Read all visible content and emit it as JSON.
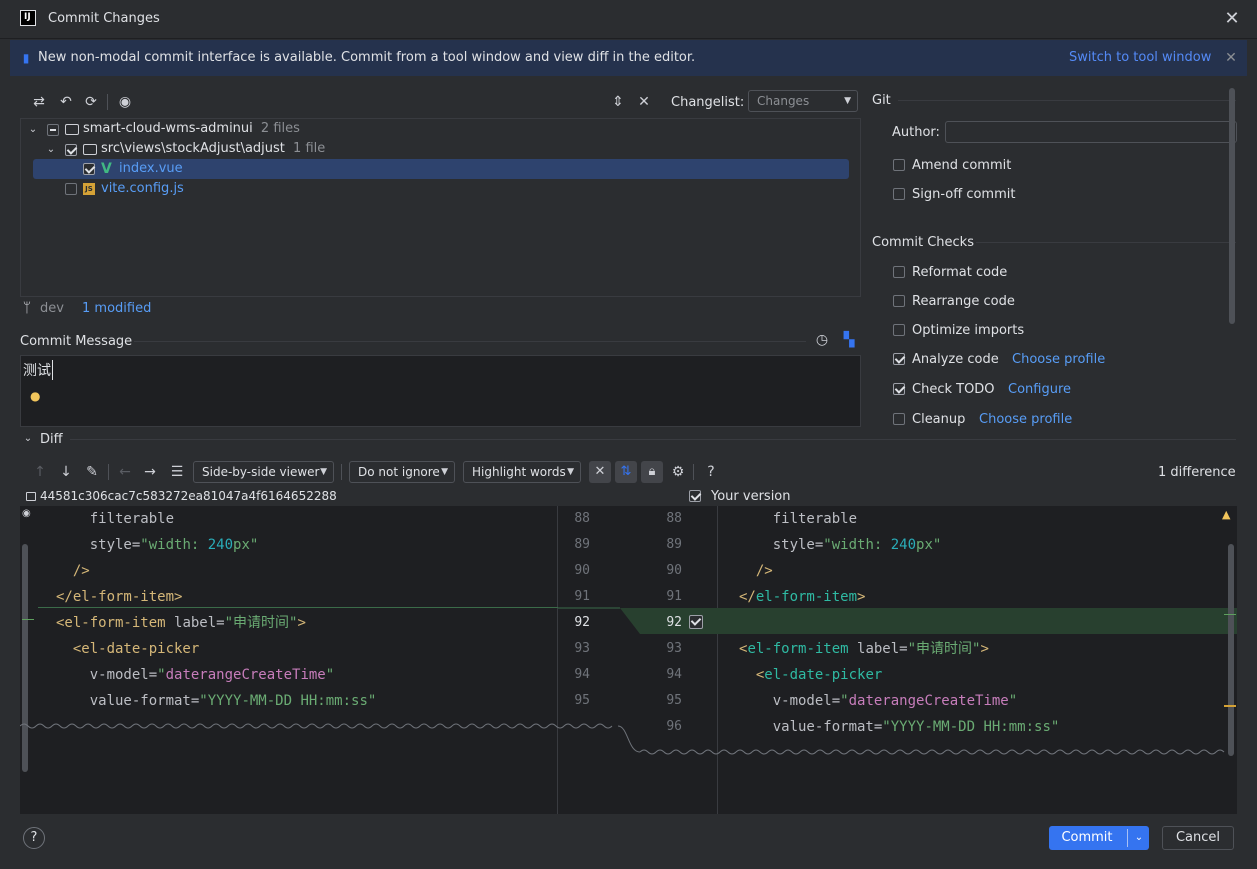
{
  "window": {
    "title": "Commit Changes"
  },
  "banner": {
    "text": "New non-modal commit interface is available. Commit from a tool window and view diff in the editor.",
    "link": "Switch to tool window"
  },
  "toolbar": {
    "changelist_label": "Changelist:",
    "changelist_value": "Changes"
  },
  "tree": {
    "root": {
      "name": "smart-cloud-wms-adminui",
      "count": "2 files"
    },
    "folder": {
      "name": "src\\views\\stockAdjust\\adjust",
      "count": "1 file"
    },
    "file1": {
      "name": "index.vue"
    },
    "file2": {
      "name": "vite.config.js"
    }
  },
  "status": {
    "branch": "dev",
    "modified": "1 modified"
  },
  "commit_message": {
    "label": "Commit Message",
    "value": "测试"
  },
  "git": {
    "section": "Git",
    "author_label": "Author:",
    "author_value": "",
    "amend": "Amend commit",
    "signoff": "Sign-off commit"
  },
  "checks": {
    "section": "Commit Checks",
    "reformat": "Reformat code",
    "rearrange": "Rearrange code",
    "optimize": "Optimize imports",
    "analyze": "Analyze code",
    "analyze_link": "Choose profile",
    "todo": "Check TODO",
    "todo_link": "Configure",
    "cleanup": "Cleanup",
    "cleanup_link": "Choose profile"
  },
  "diff": {
    "section": "Diff",
    "viewer": "Side-by-side viewer",
    "ignore": "Do not ignore",
    "highlight": "Highlight words",
    "count": "1 difference",
    "left_hash": "44581c306cac7c583272ea81047a4f6164652288",
    "right_label": "Your version",
    "left_lines": [
      "88",
      "89",
      "90",
      "91",
      "92",
      "93",
      "94",
      "95"
    ],
    "right_lines": [
      "88",
      "89",
      "90",
      "91",
      "92",
      "93",
      "94",
      "95",
      "96"
    ]
  },
  "footer": {
    "help": "?",
    "commit": "Commit",
    "cancel": "Cancel"
  },
  "colors": {
    "accent": "#3574f0",
    "background": "#2b2d30",
    "editor": "#1e1f22",
    "selection": "#2e436e",
    "inserted": "#2a4a3a"
  }
}
